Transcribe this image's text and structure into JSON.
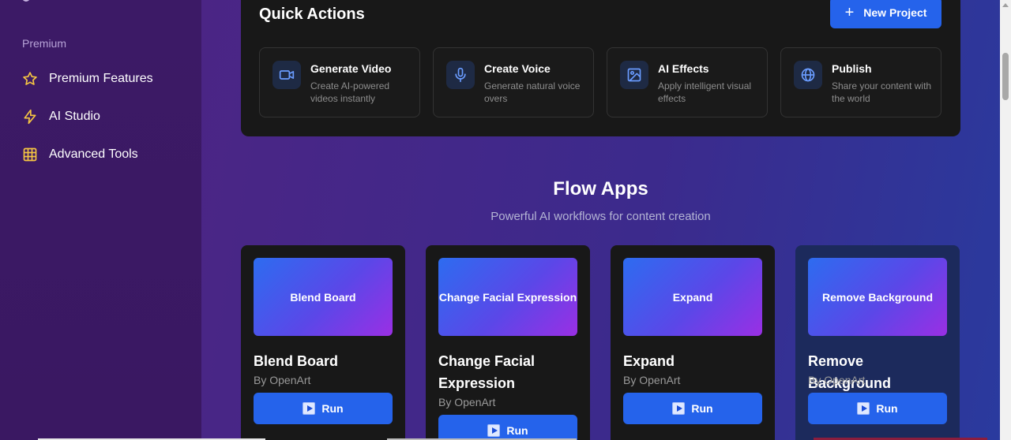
{
  "sidebar": {
    "section_label": "Premium",
    "items": [
      {
        "label": "Premium Features",
        "icon": "star-icon"
      },
      {
        "label": "AI Studio",
        "icon": "lightning-icon"
      },
      {
        "label": "Advanced Tools",
        "icon": "grid-icon"
      }
    ]
  },
  "quick_actions": {
    "title": "Quick Actions",
    "new_project_label": "New Project",
    "cards": [
      {
        "title": "Generate Video",
        "desc": "Create AI-powered videos instantly",
        "icon": "video-camera-icon"
      },
      {
        "title": "Create Voice",
        "desc": "Generate natural voice overs",
        "icon": "microphone-icon"
      },
      {
        "title": "AI Effects",
        "desc": "Apply intelligent visual effects",
        "icon": "image-icon"
      },
      {
        "title": "Publish",
        "desc": "Share your content with the world",
        "icon": "globe-icon"
      }
    ]
  },
  "flow_apps": {
    "title": "Flow Apps",
    "subtitle": "Powerful AI workflows for content creation",
    "apps": [
      {
        "thumb_label": "Blend Board",
        "name": "Blend Board",
        "by": "By OpenArt",
        "run_label": "Run"
      },
      {
        "thumb_label": "Change Facial Expression",
        "name": "Change Facial Expression",
        "by": "By OpenArt",
        "run_label": "Run"
      },
      {
        "thumb_label": "Expand",
        "name": "Expand",
        "by": "By OpenArt",
        "run_label": "Run"
      },
      {
        "thumb_label": "Remove Background",
        "name": "Remove Background",
        "by": "By OpenArt",
        "run_label": "Run"
      }
    ]
  },
  "colors": {
    "accent": "#2563eb",
    "icon_yellow": "#f5c542",
    "panel": "#181818"
  }
}
